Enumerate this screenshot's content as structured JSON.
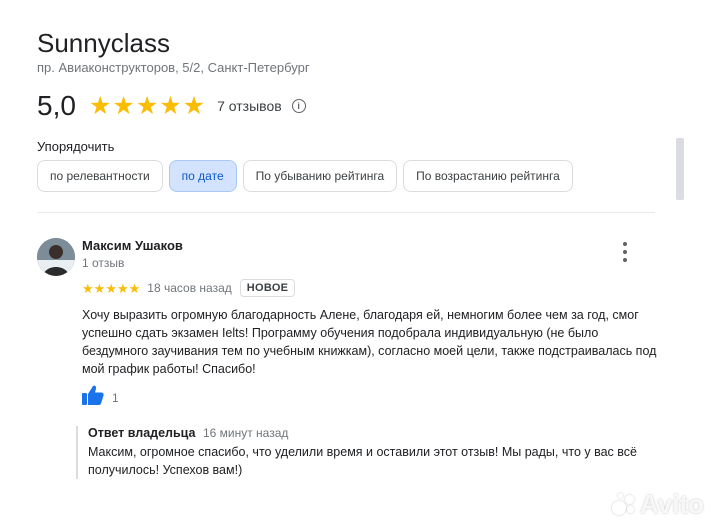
{
  "business": {
    "name": "Sunnyclass",
    "address": "пр. Авиаконструкторов, 5/2, Санкт-Петербург",
    "rating": "5,0",
    "stars": 5,
    "review_count": "7 отзывов"
  },
  "sort": {
    "label": "Упорядочить",
    "options": [
      {
        "label": "по релевантности",
        "active": false
      },
      {
        "label": "по дате",
        "active": true
      },
      {
        "label": "По убыванию рейтинга",
        "active": false
      },
      {
        "label": "По возрастанию рейтинга",
        "active": false
      }
    ]
  },
  "review": {
    "author": "Максим Ушаков",
    "author_meta": "1 отзыв",
    "stars": 5,
    "time": "18 часов назад",
    "badge": "НОВОЕ",
    "text": "Хочу выразить огромную благодарность Алене, благодаря ей, немногим более чем за год, смог успешно сдать экзамен Ielts! Программу обучения подобрала индивидуальную (не было бездумного заучивания тем по учебным книжкам), согласно моей цели, также подстраивалась под мой график работы! Спасибо!",
    "likes": "1",
    "reply": {
      "title": "Ответ владельца",
      "time": "16 минут назад",
      "text": "Максим, огромное спасибо, что уделили время и оставили этот отзыв! Мы рады, что у вас всё получилось! Успехов вам!)"
    }
  },
  "watermark": "Avito",
  "colors": {
    "star": "#fbbc04",
    "chip_active_bg": "#d3e3fd",
    "like_blue": "#1a73e8"
  },
  "icons": [
    "info-icon",
    "more-vert-icon",
    "thumb-up-icon",
    "avito-logo"
  ]
}
